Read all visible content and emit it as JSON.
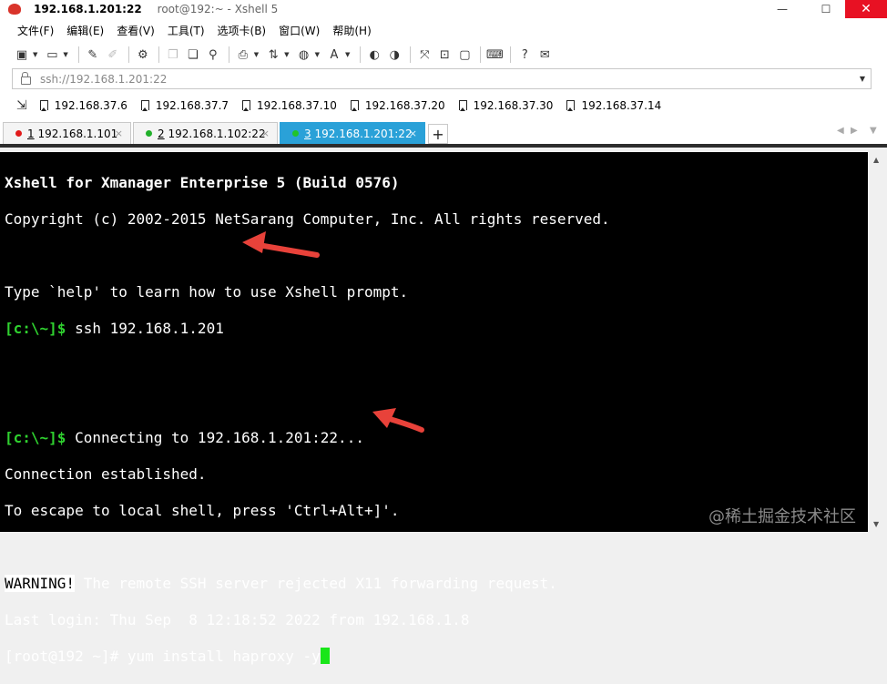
{
  "titlebar": {
    "host": "192.168.1.201:22",
    "subtitle": "root@192:~ - Xshell 5",
    "minimize_glyph": "—",
    "maximize_glyph": "☐",
    "close_glyph": "✕"
  },
  "menubar": [
    "文件(F)",
    "编辑(E)",
    "查看(V)",
    "工具(T)",
    "选项卡(B)",
    "窗口(W)",
    "帮助(H)"
  ],
  "address": {
    "value": "ssh://192.168.1.201:22"
  },
  "links": [
    "192.168.37.6",
    "192.168.37.7",
    "192.168.37.10",
    "192.168.37.20",
    "192.168.37.30",
    "192.168.37.14"
  ],
  "tabs": [
    {
      "number": "1",
      "label": "192.168.1.101",
      "status_color": "#e11a1a",
      "active": false
    },
    {
      "number": "2",
      "label": "192.168.1.102:22",
      "status_color": "#21b02a",
      "active": false
    },
    {
      "number": "3",
      "label": "192.168.1.201:22",
      "status_color": "#21c42a",
      "active": true
    }
  ],
  "tabbar": {
    "add_glyph": "+",
    "close_glyph": "×"
  },
  "terminal": {
    "banner1": "Xshell for Xmanager Enterprise 5 (Build 0576)",
    "banner2": "Copyright (c) 2002-2015 NetSarang Computer, Inc. All rights reserved.",
    "help_line": "Type `help' to learn how to use Xshell prompt.",
    "local_prompt": "[c:\\~]$",
    "ssh_command": " ssh 192.168.1.201",
    "connecting": " Connecting to 192.168.1.201:22...",
    "established": "Connection established.",
    "escape_hint": "To escape to local shell, press 'Ctrl+Alt+]'.",
    "warning_tag": "WARNING!",
    "warning_text": " The remote SSH server rejected X11 forwarding request.",
    "last_login": "Last login: Thu Sep  8 12:18:52 2022 from 192.168.1.8",
    "remote_prompt": "[root@192 ~]# yum install haproxy -y"
  },
  "annotations": {
    "arrow_color": "#e8423a"
  },
  "watermark": "@稀土掘金技术社区"
}
